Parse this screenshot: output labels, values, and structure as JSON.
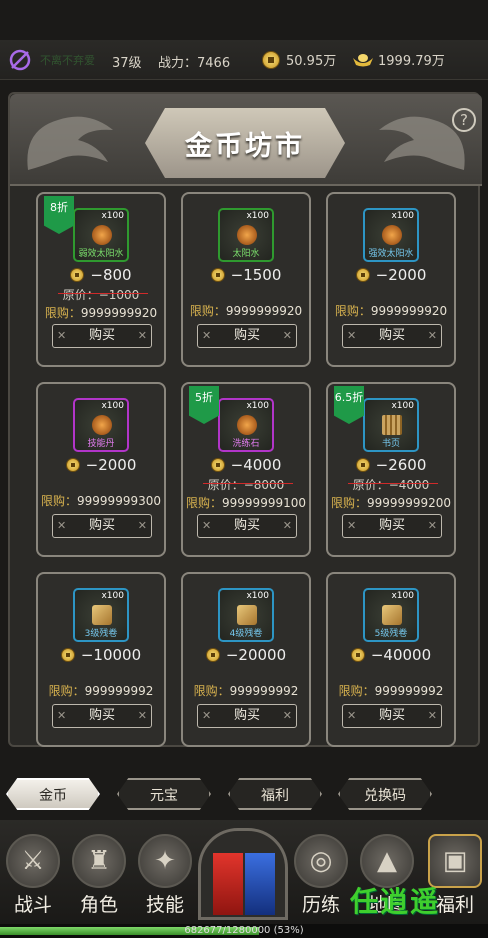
{
  "topbar": {
    "player_name": "不离不弃爱",
    "level": "37级",
    "power": "战力：7466",
    "gold": "50.95万",
    "ingot": "1999.79万"
  },
  "shop": {
    "title": "金币坊市",
    "help": "?",
    "limit_label": "限购：",
    "orig_label": "原价：",
    "buy_label": "购买",
    "items": [
      {
        "name": "弱效太阳水",
        "qty": "x100",
        "price": "−800",
        "orig": "−1000",
        "limit": "9999999920",
        "badge": "8折",
        "frame": "green",
        "art": "orb"
      },
      {
        "name": "太阳水",
        "qty": "x100",
        "price": "−1500",
        "orig": "",
        "limit": "9999999920",
        "badge": "",
        "frame": "green",
        "art": "orb"
      },
      {
        "name": "强效太阳水",
        "qty": "x100",
        "price": "−2000",
        "orig": "",
        "limit": "9999999920",
        "badge": "",
        "frame": "blue",
        "art": "orb"
      },
      {
        "name": "技能丹",
        "qty": "x100",
        "price": "−2000",
        "orig": "",
        "limit": "99999999300",
        "badge": "",
        "frame": "purple",
        "art": "orb"
      },
      {
        "name": "洗练石",
        "qty": "x100",
        "price": "−4000",
        "orig": "−8000",
        "limit": "99999999100",
        "badge": "5折",
        "frame": "purple",
        "art": "orb"
      },
      {
        "name": "书页",
        "qty": "x100",
        "price": "−2600",
        "orig": "−4000",
        "limit": "99999999200",
        "badge": "6.5折",
        "frame": "blue",
        "art": "book"
      },
      {
        "name": "3级残卷",
        "qty": "x100",
        "price": "−10000",
        "orig": "",
        "limit": "999999992",
        "badge": "",
        "frame": "blue",
        "art": "scroll"
      },
      {
        "name": "4级残卷",
        "qty": "x100",
        "price": "−20000",
        "orig": "",
        "limit": "999999992",
        "badge": "",
        "frame": "blue",
        "art": "scroll"
      },
      {
        "name": "5级残卷",
        "qty": "x100",
        "price": "−40000",
        "orig": "",
        "limit": "999999992",
        "badge": "",
        "frame": "blue",
        "art": "scroll"
      }
    ]
  },
  "tabs": [
    "金币",
    "元宝",
    "福利",
    "兑换码"
  ],
  "nav": {
    "battle": "战斗",
    "role": "角色",
    "skill": "技能",
    "train": "历练",
    "map": "地图",
    "welfare": "福利"
  },
  "exp": {
    "text": "682677/1280000 (53%)",
    "fraction": 0.53
  },
  "watermark": "任逍遥"
}
